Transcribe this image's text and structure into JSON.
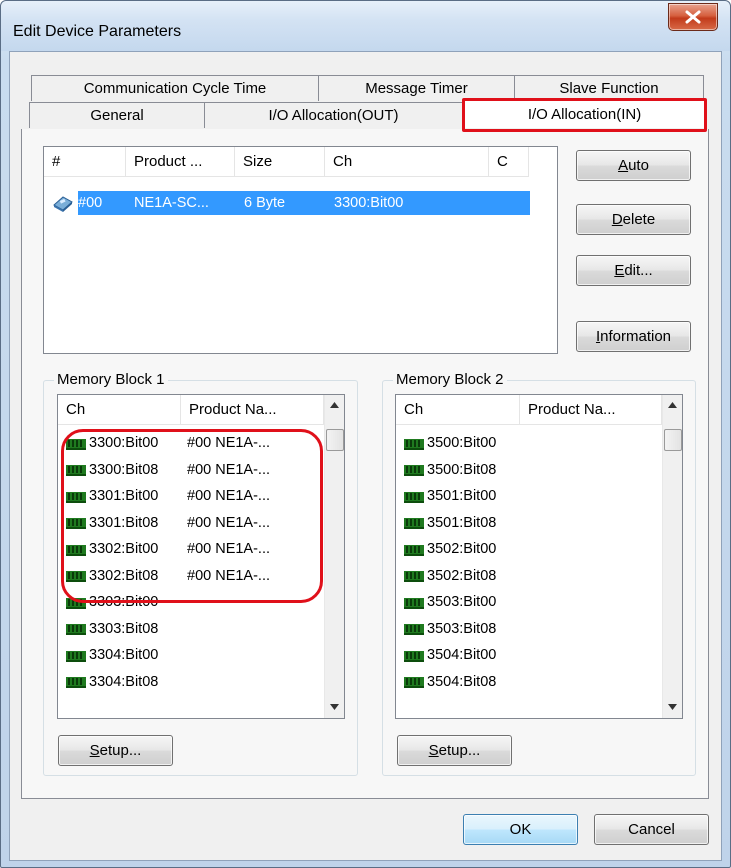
{
  "window": {
    "title": "Edit Device Parameters"
  },
  "tabs": {
    "row1": [
      "Communication Cycle Time",
      "Message Timer",
      "Slave Function"
    ],
    "row2": [
      "General",
      "I/O Allocation(OUT)",
      "I/O Allocation(IN)"
    ],
    "active": "I/O Allocation(IN)"
  },
  "device_list": {
    "columns": [
      "#",
      "Product ...",
      "Size",
      "Ch",
      "C"
    ],
    "rows": [
      {
        "num": "#00",
        "product": "NE1A-SC...",
        "size": "6 Byte",
        "ch": "3300:Bit00",
        "c": ""
      }
    ]
  },
  "side_buttons": {
    "auto": {
      "pre": "",
      "mnemonic": "A",
      "post": "uto"
    },
    "delete": {
      "pre": "",
      "mnemonic": "D",
      "post": "elete"
    },
    "edit": {
      "pre": "",
      "mnemonic": "E",
      "post": "dit..."
    },
    "information": {
      "pre": "",
      "mnemonic": "I",
      "post": "nformation"
    }
  },
  "memory_block_1": {
    "title": "Memory Block 1",
    "columns": [
      "Ch",
      "Product Na..."
    ],
    "rows": [
      {
        "ch": "3300:Bit00",
        "product": "#00 NE1A-..."
      },
      {
        "ch": "3300:Bit08",
        "product": "#00 NE1A-..."
      },
      {
        "ch": "3301:Bit00",
        "product": "#00 NE1A-..."
      },
      {
        "ch": "3301:Bit08",
        "product": "#00 NE1A-..."
      },
      {
        "ch": "3302:Bit00",
        "product": "#00 NE1A-..."
      },
      {
        "ch": "3302:Bit08",
        "product": "#00 NE1A-..."
      },
      {
        "ch": "3303:Bit00",
        "product": ""
      },
      {
        "ch": "3303:Bit08",
        "product": ""
      },
      {
        "ch": "3304:Bit00",
        "product": ""
      },
      {
        "ch": "3304:Bit08",
        "product": ""
      }
    ],
    "setup": {
      "pre": "",
      "mnemonic": "S",
      "post": "etup..."
    }
  },
  "memory_block_2": {
    "title": "Memory Block 2",
    "columns": [
      "Ch",
      "Product Na..."
    ],
    "rows": [
      {
        "ch": "3500:Bit00",
        "product": ""
      },
      {
        "ch": "3500:Bit08",
        "product": ""
      },
      {
        "ch": "3501:Bit00",
        "product": ""
      },
      {
        "ch": "3501:Bit08",
        "product": ""
      },
      {
        "ch": "3502:Bit00",
        "product": ""
      },
      {
        "ch": "3502:Bit08",
        "product": ""
      },
      {
        "ch": "3503:Bit00",
        "product": ""
      },
      {
        "ch": "3503:Bit08",
        "product": ""
      },
      {
        "ch": "3504:Bit00",
        "product": ""
      },
      {
        "ch": "3504:Bit08",
        "product": ""
      }
    ],
    "setup": {
      "pre": "",
      "mnemonic": "S",
      "post": "etup..."
    }
  },
  "footer": {
    "ok_label": "OK",
    "cancel_label": "Cancel"
  },
  "colors": {
    "selection": "#3399ff",
    "highlight": "#e0101a",
    "close_button": "#c23b1b",
    "memory_icon": "#1f7a1f"
  },
  "icons": {
    "close": "close-icon",
    "device": "device-icon",
    "memory": "memory-chip-icon"
  }
}
